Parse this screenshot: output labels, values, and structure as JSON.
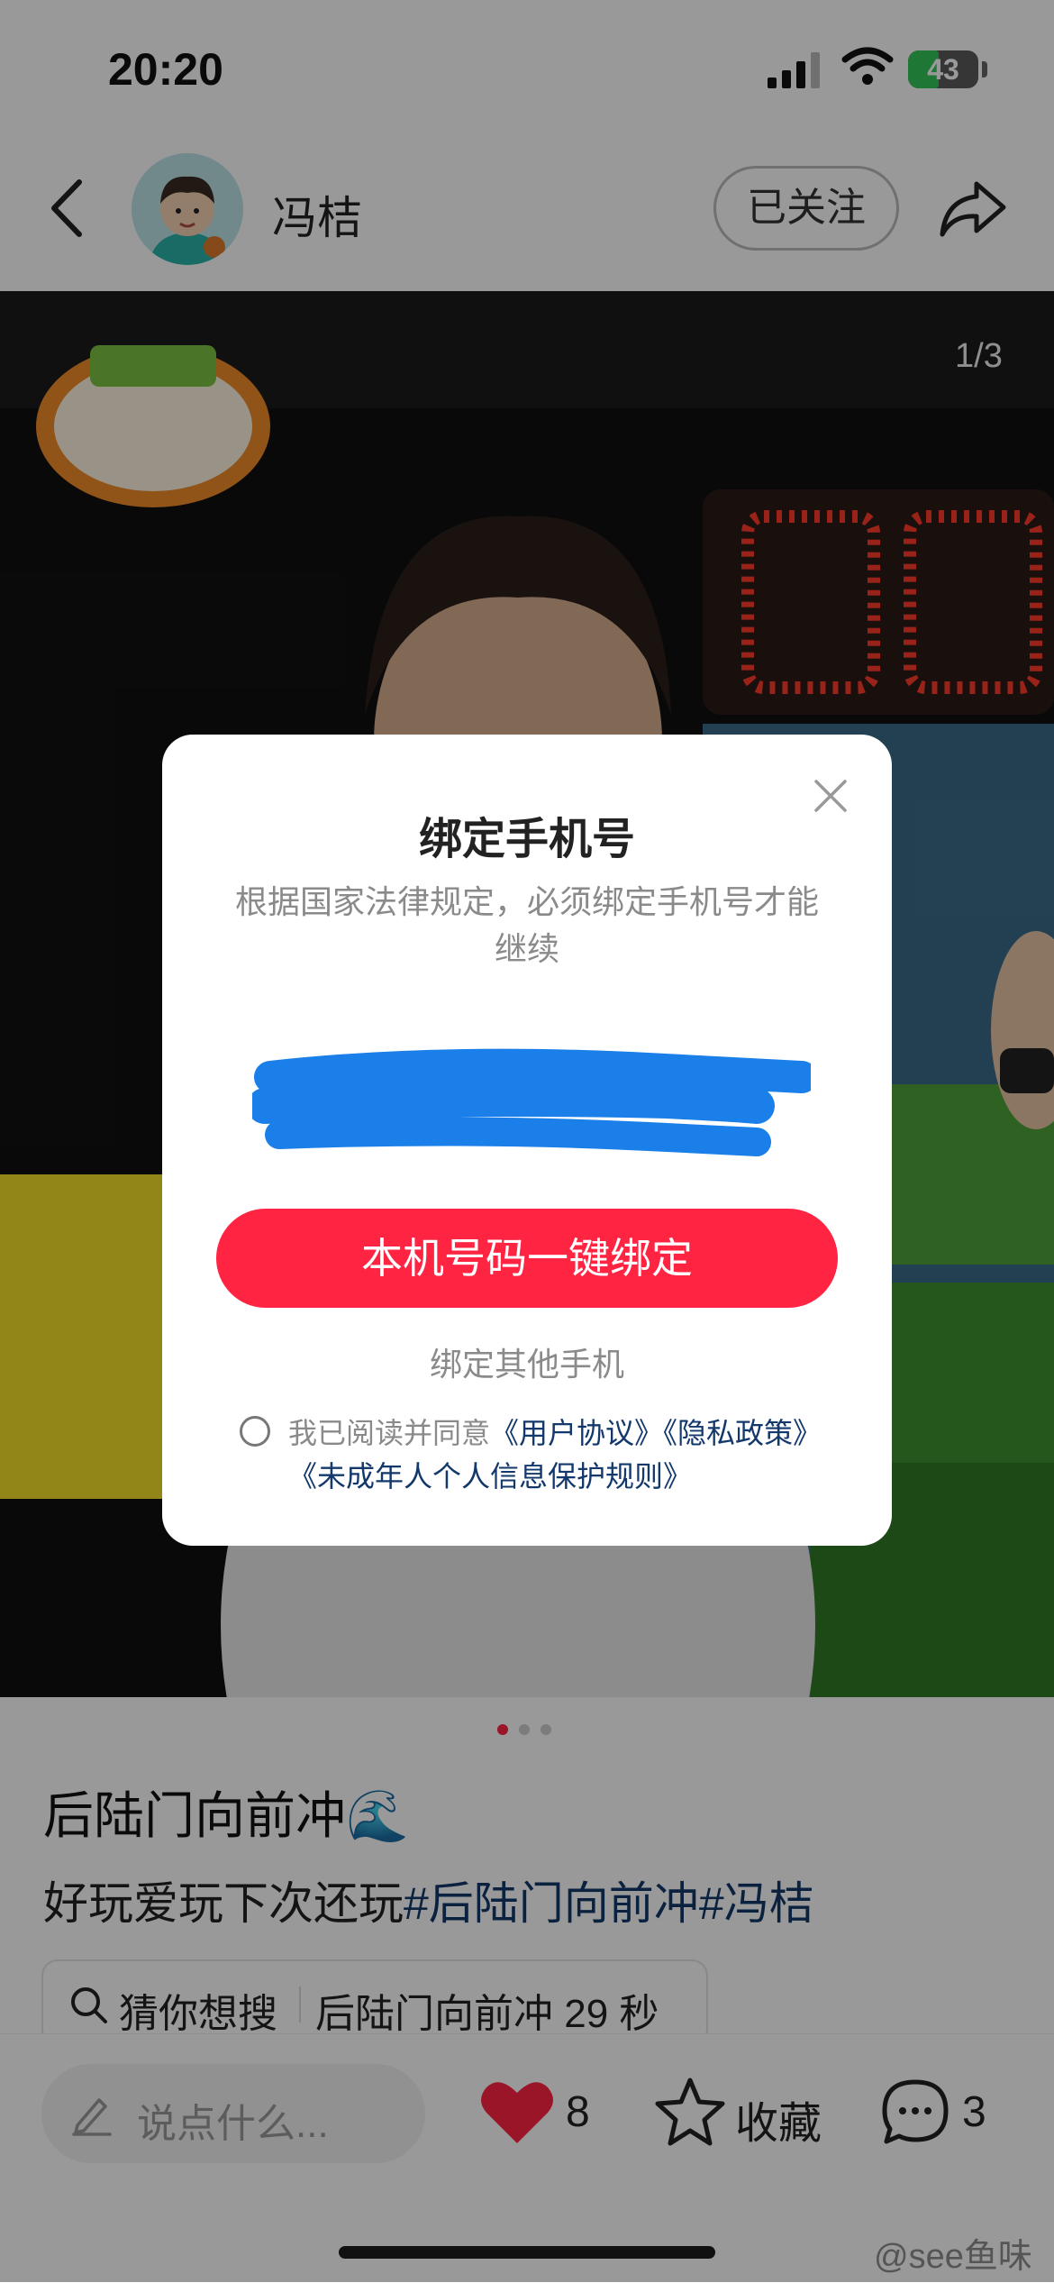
{
  "status_bar": {
    "time": "20:20",
    "battery": "43",
    "battery_level": 0.43
  },
  "header": {
    "username": "冯桔",
    "follow_label": "已关注"
  },
  "photo": {
    "page_counter": "1/3",
    "current_index": 1,
    "total": 3
  },
  "post": {
    "title": "后陆门向前冲🌊",
    "body_text": "好玩爱玩下次还玩",
    "hashtags": [
      "#后陆门向前冲",
      "#冯桔"
    ],
    "search_chip": {
      "label": "猜你想搜",
      "query": "后陆门向前冲 29 秒"
    }
  },
  "bottom_bar": {
    "comment_placeholder": "说点什么...",
    "like_count": "8",
    "collect_label": "收藏",
    "comment_count": "3"
  },
  "modal": {
    "title": "绑定手机号",
    "description": "根据国家法律规定，必须绑定手机号才能继续",
    "phone_number": "",
    "bind_button": "本机号码一键绑定",
    "bind_other": "绑定其他手机",
    "agreement": {
      "prefix": "我已阅读并同意",
      "user_agreement": "《用户协议》",
      "privacy_policy": "《隐私政策》",
      "minor_rules": "《未成年人个人信息保护规则》"
    }
  },
  "watermark": "@see鱼味",
  "colors": {
    "accent": "#ff2442",
    "link": "#13386c",
    "redaction": "#1a7fe8"
  }
}
